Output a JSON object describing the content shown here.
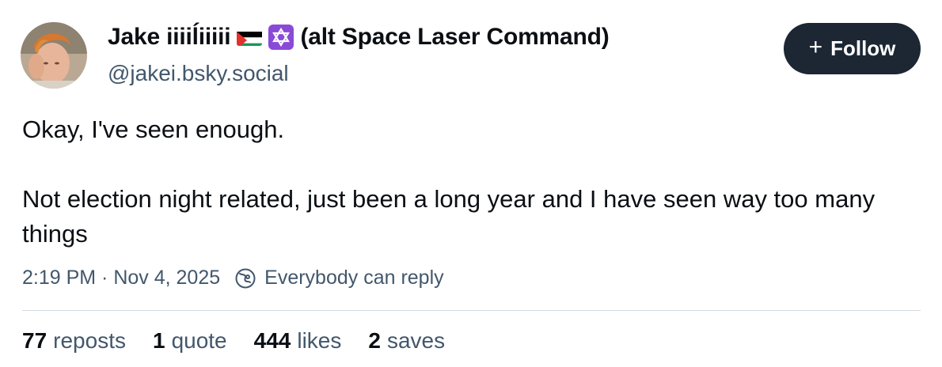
{
  "author": {
    "display_name": "Jake iiiiĺiiiii",
    "display_name_suffix": "(alt Space Laser Command)",
    "flag_icon": "palestine-flag-emoji",
    "star_icon": "star-of-david-emoji",
    "handle": "@jakei.bsky.social"
  },
  "follow_button": {
    "icon": "plus-icon",
    "label": "Follow"
  },
  "post": {
    "paragraphs": [
      "Okay, I've seen enough.",
      "Not election night related, just been a long year and I have seen way too many things"
    ]
  },
  "meta": {
    "timestamp": "2:19 PM · Nov 4, 2025",
    "reply_setting": "Everybody can reply"
  },
  "stats": [
    {
      "count": "77",
      "label": "reposts"
    },
    {
      "count": "1",
      "label": "quote"
    },
    {
      "count": "444",
      "label": "likes"
    },
    {
      "count": "2",
      "label": "saves"
    }
  ],
  "colors": {
    "text_primary": "#0b0f14",
    "text_secondary": "#42576c",
    "button_bg": "#1c2733",
    "divider": "#d4dbe2"
  }
}
